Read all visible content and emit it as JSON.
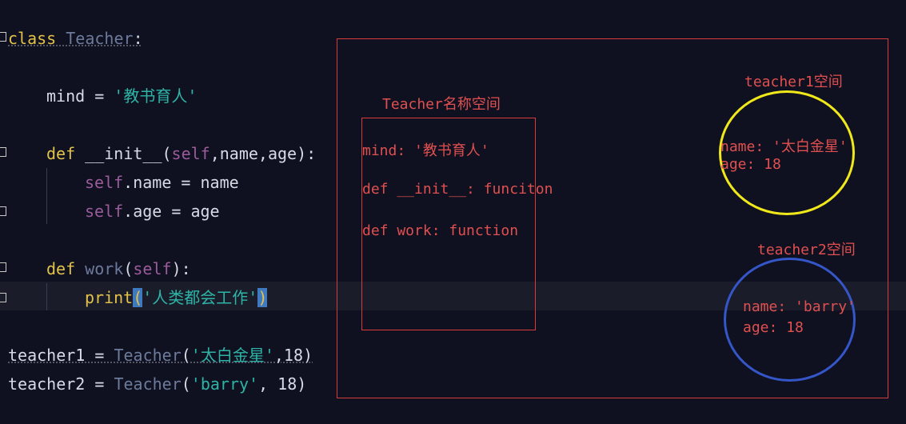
{
  "code": {
    "l1_kw": "class",
    "l1_name": "Teacher",
    "l1_colon": ":",
    "l2_var": "mind",
    "l2_eq": " = ",
    "l2_str": "'教书育人'",
    "l3_kw": "def",
    "l3_fn": "__init__",
    "l3_open": "(",
    "l3_self": "self",
    "l3_rest": ",name,age):",
    "l4_self": "self",
    "l4_rest": ".name = name",
    "l5_self": "self",
    "l5_rest": ".age = age",
    "l6_kw": "def",
    "l6_fn": "work",
    "l6_open": "(",
    "l6_self": "self",
    "l6_close": "):",
    "l7_fn": "print",
    "l7_open": "(",
    "l7_str": "'人类都会工作'",
    "l7_close": ")",
    "l8_var": "teacher1",
    "l8_eq": " = ",
    "l8_cls": "Teacher",
    "l8_open": "(",
    "l8_str": "'太白金星'",
    "l8_rest": ",18)",
    "l9_var": "teacher2",
    "l9_eq": " = ",
    "l9_cls": "Teacher",
    "l9_open": "(",
    "l9_str": "'barry'",
    "l9_rest": ", 18)"
  },
  "diagram": {
    "class_ns_title": "Teacher名称空间",
    "class_ns_items": [
      "mind: '教书育人'",
      "def __init__: funciton",
      "def work: function"
    ],
    "t1_title": "teacher1空间",
    "t1_items": [
      "name: '太白金星'",
      "age: 18"
    ],
    "t2_title": "teacher2空间",
    "t2_items": [
      "name: 'barry'",
      "age: 18"
    ]
  },
  "colors": {
    "background": "#0f1020",
    "diagram_red": "#e05050",
    "teacher1_circle": "#f0e81a",
    "teacher2_circle": "#3556c8",
    "string": "#2eb4a6",
    "keyword": "#e3c24a"
  }
}
